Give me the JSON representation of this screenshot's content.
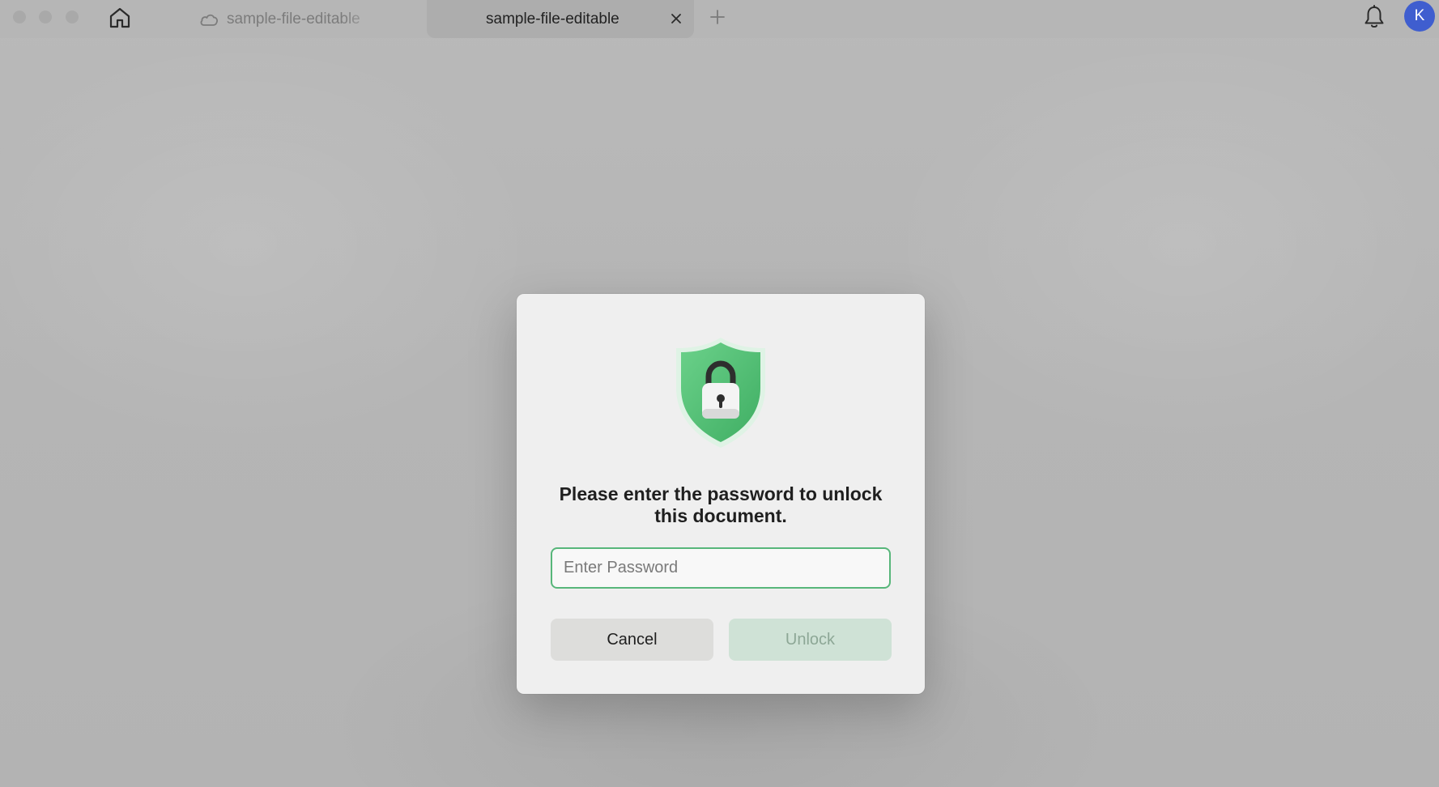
{
  "tabs": [
    {
      "label": "sample-file-editable",
      "active": false,
      "icon": "cloud-icon"
    },
    {
      "label": "sample-file-editable",
      "active": true
    }
  ],
  "toolbar": {
    "home_icon": "home-icon",
    "new_tab_icon": "plus-icon",
    "close_tab_icon": "close-icon",
    "notifications_icon": "bell-icon",
    "avatar_initial": "K"
  },
  "dialog": {
    "icon": "shield-lock-icon",
    "prompt": "Please enter the password to unlock this document.",
    "password_placeholder": "Enter Password",
    "password_value": "",
    "cancel_label": "Cancel",
    "unlock_label": "Unlock",
    "unlock_enabled": false
  },
  "colors": {
    "accent_green": "#57b67a",
    "shield_green": "#5cc47c",
    "avatar_blue": "#3f5ecf"
  }
}
